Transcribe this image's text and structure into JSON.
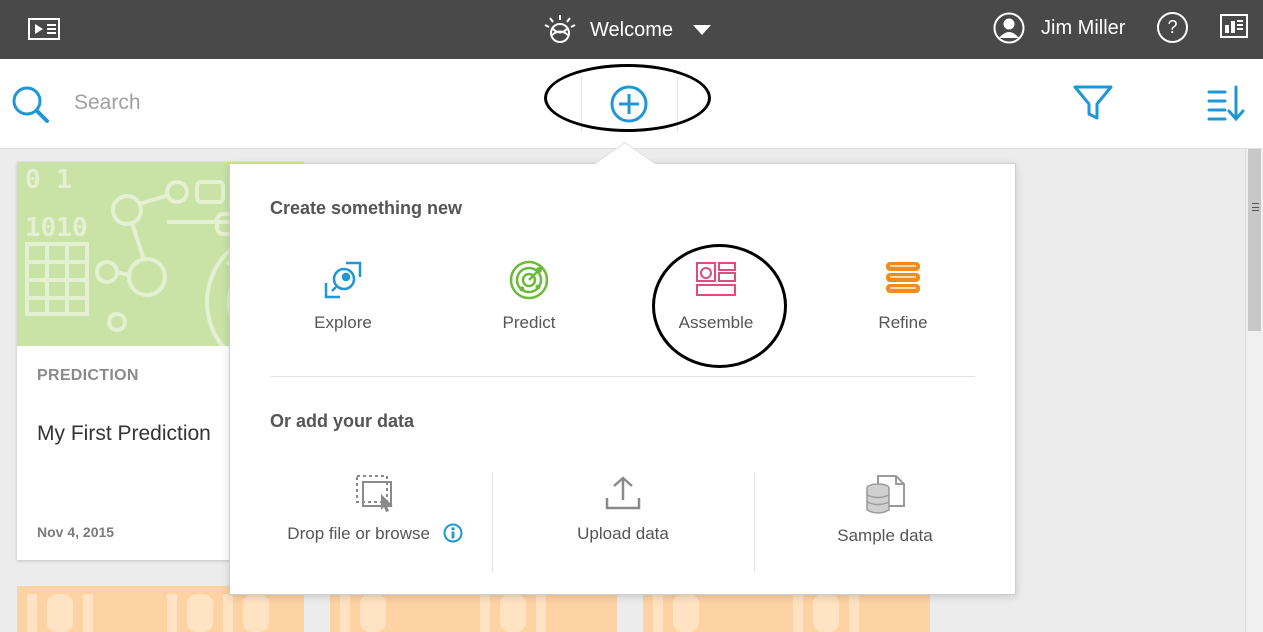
{
  "topbar": {
    "welcome_label": "Welcome",
    "user_name": "Jim Miller",
    "help_label": "?"
  },
  "toolbar": {
    "search_placeholder": "Search"
  },
  "card": {
    "kind": "PREDICTION",
    "title": "My First Prediction",
    "date": "Nov 4, 2015"
  },
  "popover": {
    "create_heading": "Create something new",
    "create_items": [
      {
        "label": "Explore",
        "icon": "explore-icon",
        "color": "#1f97d4"
      },
      {
        "label": "Predict",
        "icon": "predict-icon",
        "color": "#6cba3b"
      },
      {
        "label": "Assemble",
        "icon": "assemble-icon",
        "color": "#dd4d7d"
      },
      {
        "label": "Refine",
        "icon": "refine-icon",
        "color": "#f08c1d"
      }
    ],
    "data_heading": "Or add your data",
    "data_items": [
      {
        "label": "Drop file or browse",
        "icon": "drop-file-icon"
      },
      {
        "label": "Upload data",
        "icon": "upload-icon"
      },
      {
        "label": "Sample data",
        "icon": "sample-data-icon"
      }
    ]
  },
  "colors": {
    "accent": "#1f97d4",
    "topbar": "#494949"
  }
}
